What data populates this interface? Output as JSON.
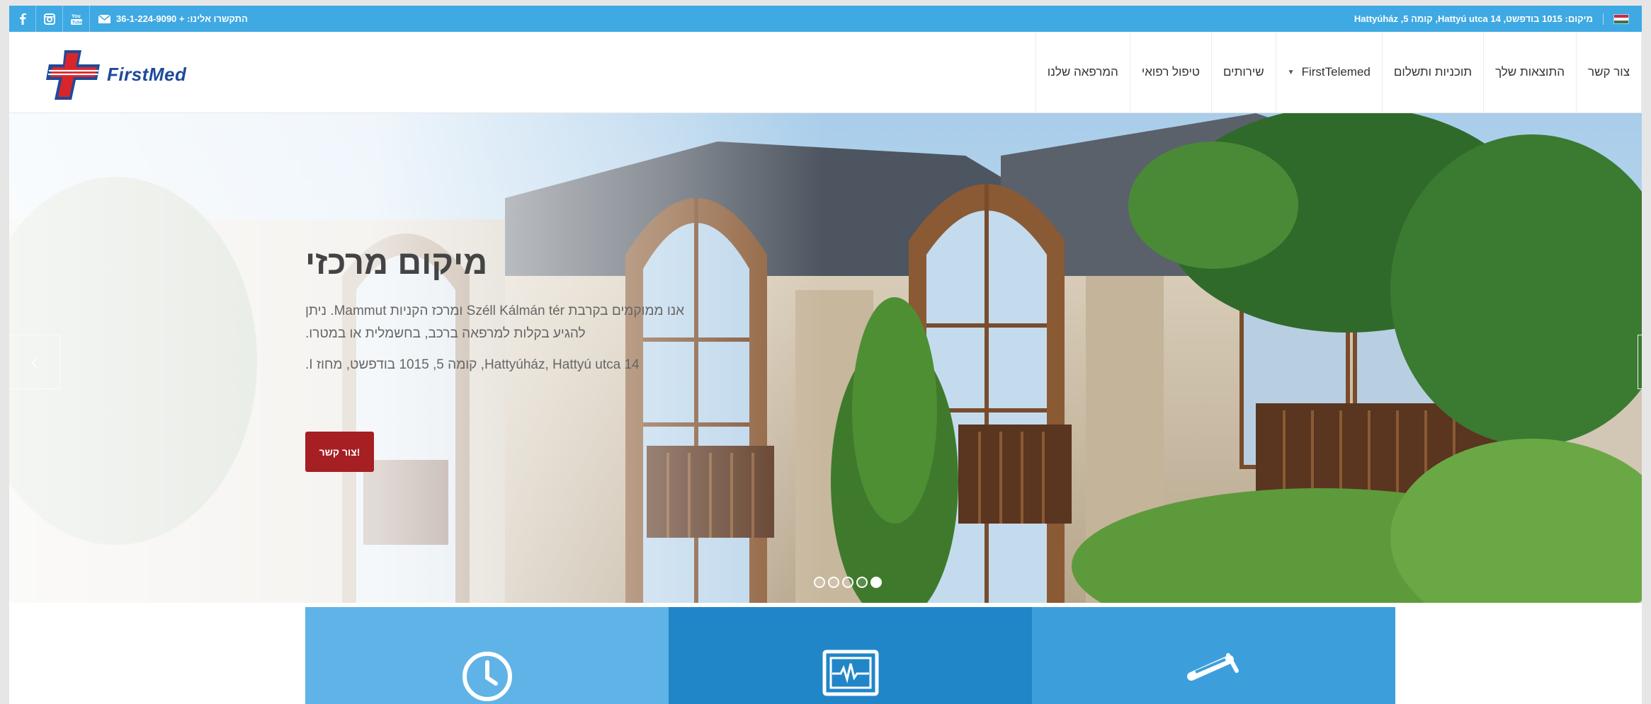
{
  "topbar": {
    "contact_text": "התקשרו אלינו: + 36-1-224-9090",
    "address_text": "מיקום: 1015 בודפשט, Hattyú utca 14, קומה 5, Hattyúház",
    "social": [
      "facebook-icon",
      "instagram-icon",
      "youtube-icon"
    ],
    "mail_icon": "mail-icon",
    "flag": "hungary-flag"
  },
  "header": {
    "logo_text": "FirstMed",
    "nav": [
      {
        "label": "צור קשר"
      },
      {
        "label": "התוצאות שלך"
      },
      {
        "label": "תוכניות ותשלום"
      },
      {
        "label": "FirstTelemed",
        "has_dropdown": true
      },
      {
        "label": "שירותים"
      },
      {
        "label": "טיפול רפואי"
      },
      {
        "label": "המרפאה שלנו"
      }
    ]
  },
  "hero": {
    "title": "מיקום מרכזי",
    "paragraph1": "אנו ממוקמים בקרבת Széll Kálmán tér ומרכז הקניות Mammut. ניתן להגיע בקלות למרפאה ברכב, בחשמלית או במטרו.",
    "paragraph2": "Hattyúház, Hattyú utca 14, קומה 5, 1015 בודפשט, מחוז I.",
    "button_label": "צור קשר!",
    "slides_count": 5,
    "active_slide": 5
  },
  "features": [
    {
      "icon": "clock-icon"
    },
    {
      "icon": "heart-monitor-icon"
    },
    {
      "icon": "test-tube-icon"
    }
  ],
  "colors": {
    "topbar": "#3fa9e3",
    "button": "#a61f23",
    "feature1": "#5fb3e6",
    "feature2": "#2186c8",
    "feature3": "#3c9fdc",
    "logo_blue": "#1e4a9a",
    "logo_red": "#d9252a"
  }
}
